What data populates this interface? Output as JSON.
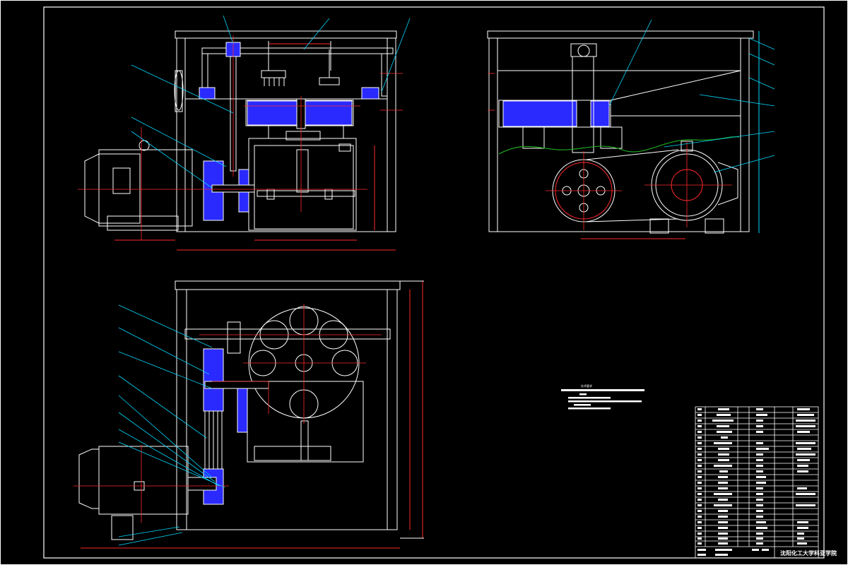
{
  "drawing": {
    "title_block": {
      "school_name": "沈阳化工大学科亚学院"
    },
    "notes_heading": "技术要求",
    "colors": {
      "outline": "#ffffff",
      "centerline": "#ff2a2a",
      "leader": "#00d8ff",
      "hatch": "#2a2aff",
      "ground": "#1fa81f",
      "dimension": "#ff2a2a"
    }
  }
}
